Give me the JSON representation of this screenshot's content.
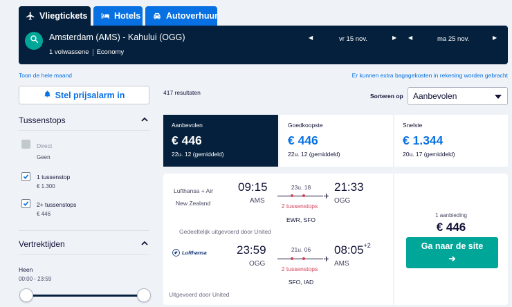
{
  "tabs": [
    {
      "label": "Vliegtickets",
      "icon": "plane-icon",
      "active": true
    },
    {
      "label": "Hotels",
      "icon": "hotel-bed-icon",
      "active": false
    },
    {
      "label": "Autoverhuur",
      "icon": "car-icon",
      "active": false
    }
  ],
  "search": {
    "route": "Amsterdam (AMS) - Kahului (OGG)",
    "passengers": "1 volwassene",
    "cabin": "Economy",
    "depart_date": "vr 15 nov.",
    "return_date": "ma 25 nov."
  },
  "links": {
    "full_month": "Toon de hele maand",
    "baggage_notice": "Er kunnen extra bagagekosten in rekening worden gebracht"
  },
  "sidebar": {
    "alarm_button": "Stel prijsalarm in",
    "stops_title": "Tussenstops",
    "stops": [
      {
        "label": "Direct",
        "price": "Geen",
        "checked": false,
        "disabled": true
      },
      {
        "label": "1 tussenstop",
        "price": "€ 1.300",
        "checked": true,
        "disabled": false
      },
      {
        "label": "2+ tussenstops",
        "price": "€ 446",
        "checked": true,
        "disabled": false
      }
    ],
    "times_title": "Vertrektijden",
    "outbound_label": "Heen",
    "outbound_range": "00:00 - 23:59"
  },
  "results": {
    "count": "417 resultaten",
    "sort_label": "Sorteren op",
    "sort_value": "Aanbevolen"
  },
  "sort_cards": [
    {
      "label": "Aanbevolen",
      "price": "€ 446",
      "duration": "22u. 12 (gemiddeld)",
      "active": true
    },
    {
      "label": "Goedkoopste",
      "price": "€ 446",
      "duration": "22u. 12 (gemiddeld)",
      "active": false
    },
    {
      "label": "Snelste",
      "price": "€ 1.344",
      "duration": "20u. 17 (gemiddeld)",
      "active": false
    }
  ],
  "result": {
    "outbound": {
      "airline": "Lufthansa + Air New Zealand",
      "airline_line1": "Lufthansa + Air",
      "airline_line2": "New Zealand",
      "depart_time": "09:15",
      "depart_airport": "AMS",
      "duration": "23u. 18",
      "stops": "2 tussenstops",
      "via": "EWR, SFO",
      "arrive_time": "21:33",
      "arrive_airport": "OGG",
      "operated": "Gedeeltelijk uitgevoerd door United"
    },
    "inbound": {
      "airline_logo_text": "Lufthansa",
      "depart_time": "23:59",
      "depart_airport": "OGG",
      "duration": "21u. 06",
      "stops": "2 tussenstops",
      "via": "SFO, IAD",
      "arrive_time": "08:05",
      "arrive_day_offset": "+2",
      "arrive_airport": "AMS",
      "operated": "Uitgevoerd door United"
    },
    "offer_count": "1 aanbieding",
    "price": "€ 446",
    "cta": "Ga naar de site",
    "cta_arrow": "➔"
  },
  "colors": {
    "navy": "#05203c",
    "blue": "#0770e3",
    "teal": "#00a698",
    "stops_red": "#d1435b",
    "background": "#eff3f8"
  }
}
